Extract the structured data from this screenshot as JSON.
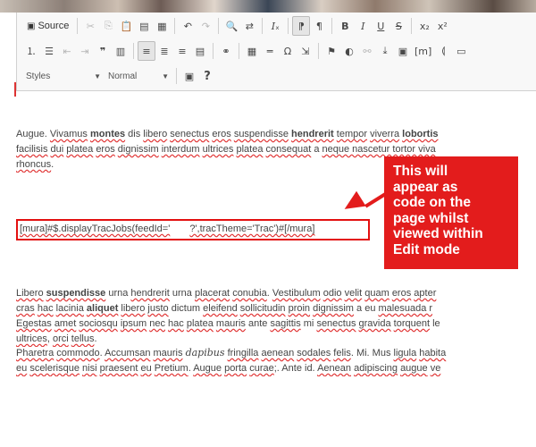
{
  "toolbar": {
    "source_label": "Source",
    "row1_icons": [
      "cut-icon",
      "copy-icon",
      "paste-icon",
      "paste-text-icon",
      "paste-word-icon",
      "undo-icon",
      "redo-icon",
      "find-icon",
      "replace-icon"
    ],
    "formatting": {
      "bold": "B",
      "italic": "I",
      "underline": "U",
      "strike": "S",
      "subscript": "x₂",
      "superscript": "x²"
    },
    "styles_combo": "Styles",
    "format_combo": "Normal",
    "help": "?",
    "omega": "Ω"
  },
  "content": {
    "para1": [
      {
        "t": "Augue. ",
        "s": ""
      },
      {
        "t": "Vivamus",
        "s": "sp"
      },
      {
        "t": " ",
        "s": ""
      },
      {
        "t": "montes",
        "s": "bold sp"
      },
      {
        "t": " dis ",
        "s": ""
      },
      {
        "t": "libero",
        "s": "sp"
      },
      {
        "t": " ",
        "s": ""
      },
      {
        "t": "senectus",
        "s": "sp"
      },
      {
        "t": " ",
        "s": ""
      },
      {
        "t": "eros",
        "s": "sp"
      },
      {
        "t": " ",
        "s": ""
      },
      {
        "t": "suspendisse",
        "s": "sp"
      },
      {
        "t": " ",
        "s": ""
      },
      {
        "t": "hendrerit",
        "s": "bold sp"
      },
      {
        "t": " ",
        "s": ""
      },
      {
        "t": "tempor",
        "s": "sp"
      },
      {
        "t": " ",
        "s": ""
      },
      {
        "t": "viverra",
        "s": "sp"
      },
      {
        "t": " ",
        "s": ""
      },
      {
        "t": "lobortis",
        "s": "bold sp"
      },
      {
        "br": true
      },
      {
        "t": "facilisis",
        "s": "sp"
      },
      {
        "t": " ",
        "s": ""
      },
      {
        "t": "dui",
        "s": "sp"
      },
      {
        "t": " ",
        "s": ""
      },
      {
        "t": "platea",
        "s": "sp"
      },
      {
        "t": " ",
        "s": ""
      },
      {
        "t": "eros",
        "s": "sp"
      },
      {
        "t": " ",
        "s": ""
      },
      {
        "t": "dignissim",
        "s": "sp"
      },
      {
        "t": " ",
        "s": ""
      },
      {
        "t": "interdum",
        "s": "sp"
      },
      {
        "t": " ",
        "s": ""
      },
      {
        "t": "ultrices",
        "s": "sp"
      },
      {
        "t": " ",
        "s": ""
      },
      {
        "t": "platea",
        "s": "sp"
      },
      {
        "t": " ",
        "s": ""
      },
      {
        "t": "consequat",
        "s": "sp"
      },
      {
        "t": " a ",
        "s": ""
      },
      {
        "t": "neque nascetur tortor viva",
        "s": "sp"
      },
      {
        "br": true
      },
      {
        "t": "rhoncus",
        "s": "sp"
      },
      {
        "t": ".",
        "s": ""
      }
    ],
    "code_before": "[mura]#$.displayTracJobs(feedId='",
    "code_after": "?',tracTheme='Trac')#[/mura]",
    "para2": [
      {
        "t": "Libero",
        "s": "sp"
      },
      {
        "t": " ",
        "s": ""
      },
      {
        "t": "suspendisse",
        "s": "bold sp"
      },
      {
        "t": " urna ",
        "s": ""
      },
      {
        "t": "hendrerit",
        "s": "sp"
      },
      {
        "t": " urna ",
        "s": ""
      },
      {
        "t": "placerat",
        "s": "sp"
      },
      {
        "t": " ",
        "s": ""
      },
      {
        "t": "conubia",
        "s": "sp"
      },
      {
        "t": ". ",
        "s": ""
      },
      {
        "t": "Vestibulum",
        "s": "sp"
      },
      {
        "t": " ",
        "s": ""
      },
      {
        "t": "odio",
        "s": "sp"
      },
      {
        "t": " ",
        "s": ""
      },
      {
        "t": "velit",
        "s": "sp"
      },
      {
        "t": " ",
        "s": ""
      },
      {
        "t": "quam",
        "s": "sp"
      },
      {
        "t": " ",
        "s": ""
      },
      {
        "t": "eros",
        "s": "sp"
      },
      {
        "t": " ",
        "s": ""
      },
      {
        "t": "apter",
        "s": "sp"
      },
      {
        "br": true
      },
      {
        "t": "cras",
        "s": "sp"
      },
      {
        "t": " ",
        "s": ""
      },
      {
        "t": "hac",
        "s": "sp"
      },
      {
        "t": " ",
        "s": ""
      },
      {
        "t": "lacinia",
        "s": "sp"
      },
      {
        "t": " ",
        "s": ""
      },
      {
        "t": "aliquet",
        "s": "bold sp"
      },
      {
        "t": " ",
        "s": ""
      },
      {
        "t": "libero",
        "s": "sp"
      },
      {
        "t": " ",
        "s": ""
      },
      {
        "t": "justo",
        "s": "sp"
      },
      {
        "t": " dictum ",
        "s": ""
      },
      {
        "t": "eleifend",
        "s": "sp"
      },
      {
        "t": " ",
        "s": ""
      },
      {
        "t": "sollicitudin",
        "s": "sp"
      },
      {
        "t": " ",
        "s": ""
      },
      {
        "t": "proin",
        "s": "sp"
      },
      {
        "t": " ",
        "s": ""
      },
      {
        "t": "dignissim",
        "s": "sp"
      },
      {
        "t": " a eu ",
        "s": ""
      },
      {
        "t": "malesuada r",
        "s": "sp"
      },
      {
        "br": true
      },
      {
        "t": "Egestas",
        "s": "sp"
      },
      {
        "t": " ",
        "s": ""
      },
      {
        "t": "amet",
        "s": "sp"
      },
      {
        "t": " ",
        "s": ""
      },
      {
        "t": "sociosqu",
        "s": "sp"
      },
      {
        "t": " ",
        "s": ""
      },
      {
        "t": "ipsum",
        "s": "sp"
      },
      {
        "t": " ",
        "s": ""
      },
      {
        "t": "nec",
        "s": "sp"
      },
      {
        "t": " ",
        "s": ""
      },
      {
        "t": "hac",
        "s": "sp"
      },
      {
        "t": " ",
        "s": ""
      },
      {
        "t": "platea",
        "s": "sp"
      },
      {
        "t": " ",
        "s": ""
      },
      {
        "t": "mauris",
        "s": "sp"
      },
      {
        "t": " ante ",
        "s": ""
      },
      {
        "t": "sagittis",
        "s": "sp"
      },
      {
        "t": " mi ",
        "s": ""
      },
      {
        "t": "senectus",
        "s": "sp"
      },
      {
        "t": " ",
        "s": ""
      },
      {
        "t": "gravida",
        "s": "sp"
      },
      {
        "t": " ",
        "s": ""
      },
      {
        "t": "torquent",
        "s": "sp"
      },
      {
        "t": " le",
        "s": ""
      },
      {
        "br": true
      },
      {
        "t": "ultrices",
        "s": "sp"
      },
      {
        "t": ", ",
        "s": ""
      },
      {
        "t": "orci",
        "s": "sp"
      },
      {
        "t": " ",
        "s": ""
      },
      {
        "t": "tellus",
        "s": "sp"
      },
      {
        "t": ".",
        "s": ""
      }
    ],
    "para3": [
      {
        "t": "Pharetra",
        "s": "sp"
      },
      {
        "t": " ",
        "s": ""
      },
      {
        "t": "commodo",
        "s": "sp"
      },
      {
        "t": ". ",
        "s": ""
      },
      {
        "t": "Accumsan",
        "s": "sp"
      },
      {
        "t": " ",
        "s": ""
      },
      {
        "t": "mauris",
        "s": "sp"
      },
      {
        "t": " ",
        "s": ""
      },
      {
        "t": "dapibus",
        "s": "ital"
      },
      {
        "t": " ",
        "s": ""
      },
      {
        "t": "fringilla",
        "s": "sp"
      },
      {
        "t": " ",
        "s": ""
      },
      {
        "t": "aenean",
        "s": "sp"
      },
      {
        "t": " ",
        "s": ""
      },
      {
        "t": "sodales",
        "s": "sp"
      },
      {
        "t": " ",
        "s": ""
      },
      {
        "t": "felis",
        "s": "sp"
      },
      {
        "t": ". Mi. Mus ",
        "s": ""
      },
      {
        "t": "ligula",
        "s": "sp"
      },
      {
        "t": " ",
        "s": ""
      },
      {
        "t": "habita",
        "s": "sp"
      },
      {
        "br": true
      },
      {
        "t": "eu",
        "s": "sp"
      },
      {
        "t": " ",
        "s": ""
      },
      {
        "t": "scelerisque",
        "s": "sp"
      },
      {
        "t": " ",
        "s": ""
      },
      {
        "t": "nisi",
        "s": "sp"
      },
      {
        "t": " ",
        "s": ""
      },
      {
        "t": "praesent",
        "s": "sp"
      },
      {
        "t": " ",
        "s": ""
      },
      {
        "t": "eu",
        "s": "sp"
      },
      {
        "t": " ",
        "s": ""
      },
      {
        "t": "Pretium",
        "s": "sp"
      },
      {
        "t": ". ",
        "s": ""
      },
      {
        "t": "Augue",
        "s": "sp"
      },
      {
        "t": " ",
        "s": ""
      },
      {
        "t": "porta",
        "s": "sp"
      },
      {
        "t": " ",
        "s": ""
      },
      {
        "t": "curae",
        "s": "sp"
      },
      {
        "t": ";. Ante id. ",
        "s": ""
      },
      {
        "t": "Aenean",
        "s": "sp"
      },
      {
        "t": " ",
        "s": ""
      },
      {
        "t": "adipiscing",
        "s": "sp"
      },
      {
        "t": " ",
        "s": ""
      },
      {
        "t": "augue",
        "s": "sp"
      },
      {
        "t": " ",
        "s": ""
      },
      {
        "t": "ve",
        "s": "sp"
      }
    ]
  },
  "callout": {
    "lines": [
      "This will",
      "appear as",
      "code on the",
      "page whilst",
      "viewed within",
      "Edit mode"
    ],
    "color": "#e31c1c"
  }
}
